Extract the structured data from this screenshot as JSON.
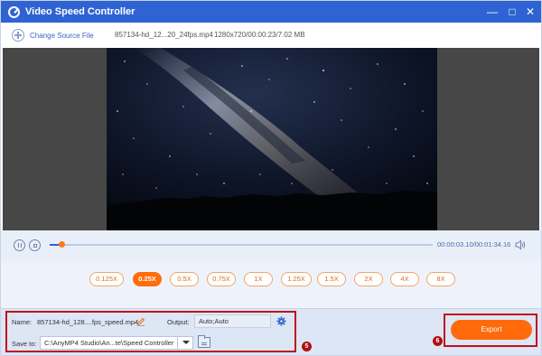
{
  "window": {
    "title": "Video Speed Controller",
    "minimize": "—",
    "maximize": "□",
    "close": "✕"
  },
  "topbar": {
    "change_source_label": "Change Source File",
    "file_name": "857134-hd_12...20_24fps.mp4",
    "file_meta": "1280x720/00:00:23/7.02 MB"
  },
  "player": {
    "time_current": "00:00:03.10",
    "time_separator": "/",
    "time_total": "00:01:34.16",
    "progress_fraction": 0.033
  },
  "speeds": {
    "options": [
      "0.125X",
      "0.25X",
      "0.5X",
      "0.75X",
      "1X",
      "1.25X",
      "1.5X",
      "2X",
      "4X",
      "8X"
    ],
    "selected": "0.25X"
  },
  "bottom": {
    "name_label": "Name:",
    "name_value": "857134-hd_128....fps_speed.mp4",
    "output_label": "Output:",
    "output_value": "Auto;Auto",
    "save_to_label": "Save to:",
    "save_to_path": "C:\\AnyMP4 Studio\\An...te\\Speed Controller",
    "export_label": "Export"
  },
  "annotations": {
    "badge_5": "5",
    "badge_6": "6",
    "highlight_color": "#c0101a"
  },
  "colors": {
    "titlebar": "#2f63d3",
    "accent_orange": "#ff6d0c"
  }
}
